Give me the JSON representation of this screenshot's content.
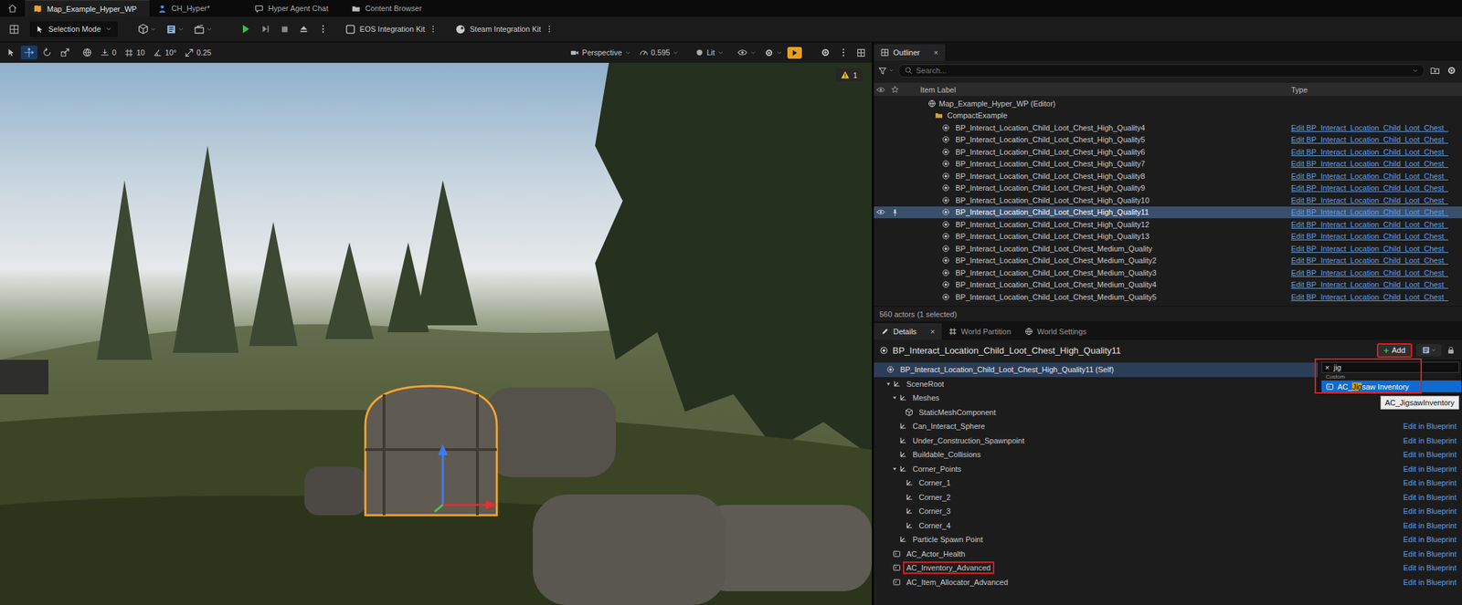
{
  "editor_tabs": [
    {
      "label": "Map_Example_Hyper_WP",
      "selected": true
    },
    {
      "label": "CH_Hyper*",
      "selected": false
    },
    {
      "label": "Hyper Agent Chat",
      "selected": false
    },
    {
      "label": "Content Browser",
      "selected": false
    }
  ],
  "toolbar": {
    "mode": "Selection Mode",
    "plugins": [
      "EOS Integration Kit",
      "Steam Integration Kit"
    ]
  },
  "viewport": {
    "tools": [
      {
        "selected": false
      },
      {
        "selected": true
      },
      {
        "selected": false
      },
      {
        "selected": false
      }
    ],
    "snaps": [
      "0",
      "10",
      "10°",
      "0.25"
    ],
    "view_mode": "Perspective",
    "camera_speed": "0.595",
    "lighting": "Lit",
    "realtime_on": true,
    "warning_count": "1"
  },
  "outliner": {
    "title": "Outliner",
    "close": "×",
    "search_placeholder": "Search...",
    "columns": [
      "Item Label",
      "Type"
    ],
    "rows": [
      {
        "label": "Map_Example_Hyper_WP (Editor)",
        "kind": "world",
        "depth": 0,
        "selected": false
      },
      {
        "label": "CompactExample",
        "kind": "folder",
        "depth": 1,
        "selected": false
      },
      {
        "label": "BP_Interact_Location_Child_Loot_Chest_High_Quality4",
        "kind": "actor",
        "depth": 2,
        "type": "Edit BP_Interact_Location_Child_Loot_Chest_",
        "selected": false
      },
      {
        "label": "BP_Interact_Location_Child_Loot_Chest_High_Quality5",
        "kind": "actor",
        "depth": 2,
        "type": "Edit BP_Interact_Location_Child_Loot_Chest_",
        "selected": false
      },
      {
        "label": "BP_Interact_Location_Child_Loot_Chest_High_Quality6",
        "kind": "actor",
        "depth": 2,
        "type": "Edit BP_Interact_Location_Child_Loot_Chest_",
        "selected": false
      },
      {
        "label": "BP_Interact_Location_Child_Loot_Chest_High_Quality7",
        "kind": "actor",
        "depth": 2,
        "type": "Edit BP_Interact_Location_Child_Loot_Chest_",
        "selected": false
      },
      {
        "label": "BP_Interact_Location_Child_Loot_Chest_High_Quality8",
        "kind": "actor",
        "depth": 2,
        "type": "Edit BP_Interact_Location_Child_Loot_Chest_",
        "selected": false
      },
      {
        "label": "BP_Interact_Location_Child_Loot_Chest_High_Quality9",
        "kind": "actor",
        "depth": 2,
        "type": "Edit BP_Interact_Location_Child_Loot_Chest_",
        "selected": false
      },
      {
        "label": "BP_Interact_Location_Child_Loot_Chest_High_Quality10",
        "kind": "actor",
        "depth": 2,
        "type": "Edit BP_Interact_Location_Child_Loot_Chest_",
        "selected": false
      },
      {
        "label": "BP_Interact_Location_Child_Loot_Chest_High_Quality11",
        "kind": "actor",
        "depth": 2,
        "type": "Edit BP_Interact_Location_Child_Loot_Chest_",
        "selected": true
      },
      {
        "label": "BP_Interact_Location_Child_Loot_Chest_High_Quality12",
        "kind": "actor",
        "depth": 2,
        "type": "Edit BP_Interact_Location_Child_Loot_Chest_",
        "selected": false
      },
      {
        "label": "BP_Interact_Location_Child_Loot_Chest_High_Quality13",
        "kind": "actor",
        "depth": 2,
        "type": "Edit BP_Interact_Location_Child_Loot_Chest_",
        "selected": false
      },
      {
        "label": "BP_Interact_Location_Child_Loot_Chest_Medium_Quality",
        "kind": "actor",
        "depth": 2,
        "type": "Edit BP_Interact_Location_Child_Loot_Chest_",
        "selected": false
      },
      {
        "label": "BP_Interact_Location_Child_Loot_Chest_Medium_Quality2",
        "kind": "actor",
        "depth": 2,
        "type": "Edit BP_Interact_Location_Child_Loot_Chest_",
        "selected": false
      },
      {
        "label": "BP_Interact_Location_Child_Loot_Chest_Medium_Quality3",
        "kind": "actor",
        "depth": 2,
        "type": "Edit BP_Interact_Location_Child_Loot_Chest_",
        "selected": false
      },
      {
        "label": "BP_Interact_Location_Child_Loot_Chest_Medium_Quality4",
        "kind": "actor",
        "depth": 2,
        "type": "Edit BP_Interact_Location_Child_Loot_Chest_",
        "selected": false
      },
      {
        "label": "BP_Interact_Location_Child_Loot_Chest_Medium_Quality5",
        "kind": "actor",
        "depth": 2,
        "type": "Edit BP_Interact_Location_Child_Loot_Chest_",
        "selected": false
      }
    ],
    "footer": "560 actors (1 selected)"
  },
  "details": {
    "tabs": [
      {
        "label": "Details",
        "selected": true,
        "close": "×"
      },
      {
        "label": "World Partition",
        "selected": false
      },
      {
        "label": "World Settings",
        "selected": false
      }
    ],
    "actor_name": "BP_Interact_Location_Child_Loot_Chest_High_Quality11",
    "add_button": {
      "icon": "+",
      "label": "Add",
      "annotated": true
    },
    "components": [
      {
        "label": "BP_Interact_Location_Child_Loot_Chest_High_Quality11 (Self)",
        "kind": "self",
        "depth": 0,
        "selected": true,
        "annotated": false
      },
      {
        "label": "SceneRoot",
        "kind": "scene",
        "depth": 1,
        "expanded": true,
        "selected": false,
        "annotated": false
      },
      {
        "label": "Meshes",
        "kind": "scene",
        "depth": 2,
        "expanded": true,
        "selected": false,
        "annotated": false
      },
      {
        "label": "StaticMeshComponent",
        "kind": "mesh",
        "depth": 3,
        "selected": false,
        "annotated": false
      },
      {
        "label": "Can_Interact_Sphere",
        "kind": "scene",
        "depth": 2,
        "selected": false,
        "annotated": false,
        "edit": "Edit in Blueprint"
      },
      {
        "label": "Under_Construction_Spawnpoint",
        "kind": "scene",
        "depth": 2,
        "selected": false,
        "annotated": false,
        "edit": "Edit in Blueprint"
      },
      {
        "label": "Buildable_Collisions",
        "kind": "scene",
        "depth": 2,
        "selected": false,
        "annotated": false,
        "edit": "Edit in Blueprint"
      },
      {
        "label": "Corner_Points",
        "kind": "scene",
        "depth": 2,
        "expanded": true,
        "selected": false,
        "annotated": false,
        "edit": "Edit in Blueprint"
      },
      {
        "label": "Corner_1",
        "kind": "scene",
        "depth": 3,
        "selected": false,
        "annotated": false,
        "edit": "Edit in Blueprint"
      },
      {
        "label": "Corner_2",
        "kind": "scene",
        "depth": 3,
        "selected": false,
        "annotated": false,
        "edit": "Edit in Blueprint"
      },
      {
        "label": "Corner_3",
        "kind": "scene",
        "depth": 3,
        "selected": false,
        "annotated": false,
        "edit": "Edit in Blueprint"
      },
      {
        "label": "Corner_4",
        "kind": "scene",
        "depth": 3,
        "selected": false,
        "annotated": false,
        "edit": "Edit in Blueprint"
      },
      {
        "label": "Particle Spawn Point",
        "kind": "scene",
        "depth": 2,
        "selected": false,
        "annotated": false,
        "edit": "Edit in Blueprint"
      },
      {
        "label": "AC_Actor_Health",
        "kind": "component",
        "depth": 1,
        "selected": false,
        "annotated": false,
        "edit": "Edit in Blueprint"
      },
      {
        "label": "AC_Inventory_Advanced",
        "kind": "component",
        "depth": 1,
        "selected": false,
        "annotated": true,
        "edit": "Edit in Blueprint"
      },
      {
        "label": "AC_Item_Allocator_Advanced",
        "kind": "component",
        "depth": 1,
        "selected": false,
        "annotated": false,
        "edit": "Edit in Blueprint"
      }
    ],
    "add_menu": {
      "clear": "×",
      "query": "jig",
      "category": "Custom",
      "items": [
        {
          "parts": [
            {
              "text": "AC_",
              "match": false
            },
            {
              "text": "Jig",
              "match": true
            },
            {
              "text": "saw Inventory",
              "match": false
            }
          ],
          "selected": true
        }
      ],
      "annotated": true,
      "tooltip": "AC_JigsawInventory"
    }
  }
}
